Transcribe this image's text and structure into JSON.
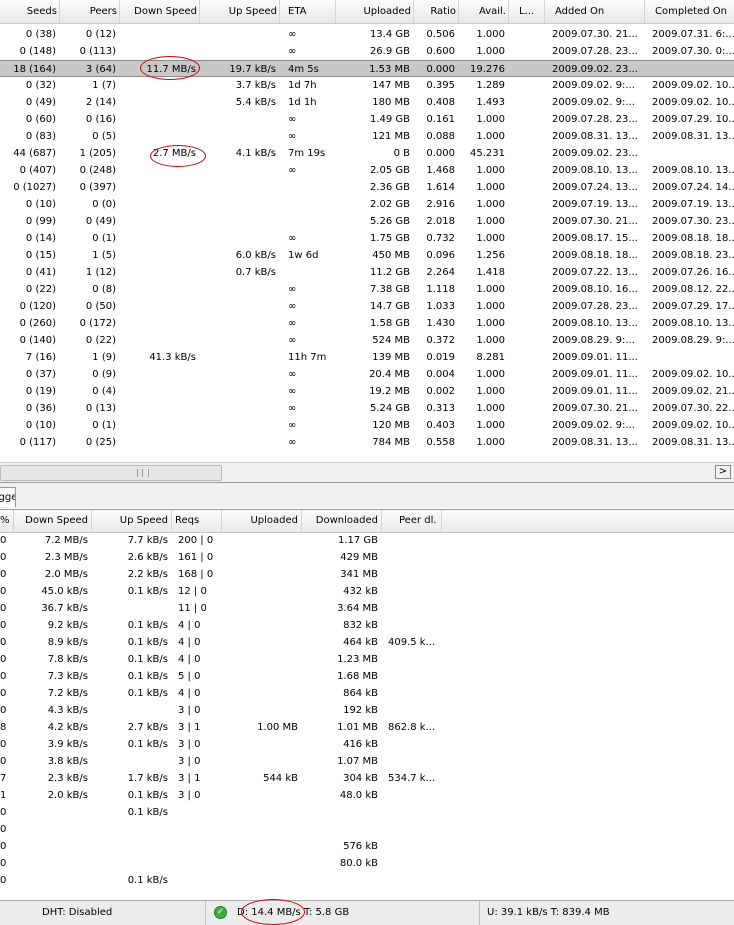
{
  "torrents": {
    "columns": [
      "Seeds",
      "Peers",
      "Down Speed",
      "Up Speed",
      "ETA",
      "Uploaded",
      "Ratio",
      "Avail.",
      "L...",
      "Added On",
      "Completed On"
    ],
    "rows": [
      [
        "0 (38)",
        "0 (12)",
        "",
        "",
        "∞",
        "13.4 GB",
        "0.506",
        "1.000",
        "",
        "2009.07.30. 21...",
        "2009.07.31. 6:..."
      ],
      [
        "0 (148)",
        "0 (113)",
        "",
        "",
        "∞",
        "26.9 GB",
        "0.600",
        "1.000",
        "",
        "2009.07.28. 23...",
        "2009.07.30. 0:..."
      ],
      [
        "18 (164)",
        "3 (64)",
        "11.7 MB/s",
        "19.7 kB/s",
        "4m 5s",
        "1.53 MB",
        "0.000",
        "19.276",
        "",
        "2009.09.02. 23...",
        ""
      ],
      [
        "0 (32)",
        "1 (7)",
        "",
        "3.7 kB/s",
        "1d 7h",
        "147 MB",
        "0.395",
        "1.289",
        "",
        "2009.09.02. 9:...",
        "2009.09.02. 10..."
      ],
      [
        "0 (49)",
        "2 (14)",
        "",
        "5.4 kB/s",
        "1d 1h",
        "180 MB",
        "0.408",
        "1.493",
        "",
        "2009.09.02. 9:...",
        "2009.09.02. 10..."
      ],
      [
        "0 (60)",
        "0 (16)",
        "",
        "",
        "∞",
        "1.49 GB",
        "0.161",
        "1.000",
        "",
        "2009.07.28. 23...",
        "2009.07.29. 10..."
      ],
      [
        "0 (83)",
        "0 (5)",
        "",
        "",
        "∞",
        "121 MB",
        "0.088",
        "1.000",
        "",
        "2009.08.31. 13...",
        "2009.08.31. 13..."
      ],
      [
        "44 (687)",
        "1 (205)",
        "2.7 MB/s",
        "4.1 kB/s",
        "7m 19s",
        "0 B",
        "0.000",
        "45.231",
        "",
        "2009.09.02. 23...",
        ""
      ],
      [
        "0 (407)",
        "0 (248)",
        "",
        "",
        "∞",
        "2.05 GB",
        "1.468",
        "1.000",
        "",
        "2009.08.10. 13...",
        "2009.08.10. 13..."
      ],
      [
        "0 (1027)",
        "0 (397)",
        "",
        "",
        "",
        "2.36 GB",
        "1.614",
        "1.000",
        "",
        "2009.07.24. 13...",
        "2009.07.24. 14..."
      ],
      [
        "0 (10)",
        "0 (0)",
        "",
        "",
        "",
        "2.02 GB",
        "2.916",
        "1.000",
        "",
        "2009.07.19. 13...",
        "2009.07.19. 13..."
      ],
      [
        "0 (99)",
        "0 (49)",
        "",
        "",
        "",
        "5.26 GB",
        "2.018",
        "1.000",
        "",
        "2009.07.30. 21...",
        "2009.07.30. 23..."
      ],
      [
        "0 (14)",
        "0 (1)",
        "",
        "",
        "∞",
        "1.75 GB",
        "0.732",
        "1.000",
        "",
        "2009.08.17. 15...",
        "2009.08.18. 18..."
      ],
      [
        "0 (15)",
        "1 (5)",
        "",
        "6.0 kB/s",
        "1w 6d",
        "450 MB",
        "0.096",
        "1.256",
        "",
        "2009.08.18. 18...",
        "2009.08.18. 23..."
      ],
      [
        "0 (41)",
        "1 (12)",
        "",
        "0.7 kB/s",
        "",
        "11.2 GB",
        "2.264",
        "1.418",
        "",
        "2009.07.22. 13...",
        "2009.07.26. 16..."
      ],
      [
        "0 (22)",
        "0 (8)",
        "",
        "",
        "∞",
        "7.38 GB",
        "1.118",
        "1.000",
        "",
        "2009.08.10. 16...",
        "2009.08.12. 22..."
      ],
      [
        "0 (120)",
        "0 (50)",
        "",
        "",
        "∞",
        "14.7 GB",
        "1.033",
        "1.000",
        "",
        "2009.07.28. 23...",
        "2009.07.29. 17..."
      ],
      [
        "0 (260)",
        "0 (172)",
        "",
        "",
        "∞",
        "1.58 GB",
        "1.430",
        "1.000",
        "",
        "2009.08.10. 13...",
        "2009.08.10. 13..."
      ],
      [
        "0 (140)",
        "0 (22)",
        "",
        "",
        "∞",
        "524 MB",
        "0.372",
        "1.000",
        "",
        "2009.08.29. 9:...",
        "2009.08.29. 9:..."
      ],
      [
        "7 (16)",
        "1 (9)",
        "41.3 kB/s",
        "",
        "11h 7m",
        "139 MB",
        "0.019",
        "8.281",
        "",
        "2009.09.01. 11...",
        ""
      ],
      [
        "0 (37)",
        "0 (9)",
        "",
        "",
        "∞",
        "20.4 MB",
        "0.004",
        "1.000",
        "",
        "2009.09.01. 11...",
        "2009.09.02. 10..."
      ],
      [
        "0 (19)",
        "0 (4)",
        "",
        "",
        "∞",
        "19.2 MB",
        "0.002",
        "1.000",
        "",
        "2009.09.01. 11...",
        "2009.09.02. 21..."
      ],
      [
        "0 (36)",
        "0 (13)",
        "",
        "",
        "∞",
        "5.24 GB",
        "0.313",
        "1.000",
        "",
        "2009.07.30. 21...",
        "2009.07.30. 22..."
      ],
      [
        "0 (10)",
        "0 (1)",
        "",
        "",
        "∞",
        "120 MB",
        "0.403",
        "1.000",
        "",
        "2009.09.02. 9:...",
        "2009.09.02. 10..."
      ],
      [
        "0 (117)",
        "0 (25)",
        "",
        "",
        "∞",
        "784 MB",
        "0.558",
        "1.000",
        "",
        "2009.08.31. 13...",
        "2009.08.31. 13..."
      ]
    ],
    "selected_row": 2
  },
  "scrollbar": {
    "right_arrow": ">"
  },
  "tabs": {
    "peers_tab": "Logger"
  },
  "peers": {
    "columns": [
      "%",
      "Down Speed",
      "Up Speed",
      "Reqs",
      "Uploaded",
      "Downloaded",
      "Peer dl."
    ],
    "rows": [
      [
        "0",
        "7.2 MB/s",
        "7.7 kB/s",
        "200 | 0",
        "",
        "1.17 GB",
        ""
      ],
      [
        "0",
        "2.3 MB/s",
        "2.6 kB/s",
        "161 | 0",
        "",
        "429 MB",
        ""
      ],
      [
        "0",
        "2.0 MB/s",
        "2.2 kB/s",
        "168 | 0",
        "",
        "341 MB",
        ""
      ],
      [
        "0",
        "45.0 kB/s",
        "0.1 kB/s",
        "12 | 0",
        "",
        "432 kB",
        ""
      ],
      [
        "0",
        "36.7 kB/s",
        "",
        "11 | 0",
        "",
        "3.64 MB",
        ""
      ],
      [
        "0",
        "9.2 kB/s",
        "0.1 kB/s",
        "4 | 0",
        "",
        "832 kB",
        ""
      ],
      [
        "0",
        "8.9 kB/s",
        "0.1 kB/s",
        "4 | 0",
        "",
        "464 kB",
        "409.5 k..."
      ],
      [
        "0",
        "7.8 kB/s",
        "0.1 kB/s",
        "4 | 0",
        "",
        "1.23 MB",
        ""
      ],
      [
        "0",
        "7.3 kB/s",
        "0.1 kB/s",
        "5 | 0",
        "",
        "1.68 MB",
        ""
      ],
      [
        "0",
        "7.2 kB/s",
        "0.1 kB/s",
        "4 | 0",
        "",
        "864 kB",
        ""
      ],
      [
        "0",
        "4.3 kB/s",
        "",
        "3 | 0",
        "",
        "192 kB",
        ""
      ],
      [
        "8",
        "4.2 kB/s",
        "2.7 kB/s",
        "3 | 1",
        "1.00 MB",
        "1.01 MB",
        "862.8 k..."
      ],
      [
        "0",
        "3.9 kB/s",
        "0.1 kB/s",
        "3 | 0",
        "",
        "416 kB",
        ""
      ],
      [
        "0",
        "3.8 kB/s",
        "",
        "3 | 0",
        "",
        "1.07 MB",
        ""
      ],
      [
        "7",
        "2.3 kB/s",
        "1.7 kB/s",
        "3 | 1",
        "544 kB",
        "304 kB",
        "534.7 k..."
      ],
      [
        "1",
        "2.0 kB/s",
        "0.1 kB/s",
        "3 | 0",
        "",
        "48.0 kB",
        ""
      ],
      [
        "0",
        "",
        "0.1 kB/s",
        "",
        "",
        "",
        ""
      ],
      [
        "0",
        "",
        "",
        "",
        "",
        "",
        ""
      ],
      [
        "0",
        "",
        "",
        "",
        "",
        "576 kB",
        ""
      ],
      [
        "0",
        "",
        "",
        "",
        "",
        "80.0 kB",
        ""
      ],
      [
        "0",
        "",
        "0.1 kB/s",
        "",
        "",
        "",
        ""
      ]
    ]
  },
  "statusbar": {
    "dht": "DHT: Disabled",
    "download": "D: 14.4 MB/s T: 5.8 GB",
    "upload": "U: 39.1 kB/s T: 839.4 MB"
  },
  "colors": {
    "annotation": "#d80000",
    "selection": "#c8c8c8",
    "ok_icon": "#3fae3f"
  },
  "icons": {
    "network_ok": "check-circle-icon"
  }
}
